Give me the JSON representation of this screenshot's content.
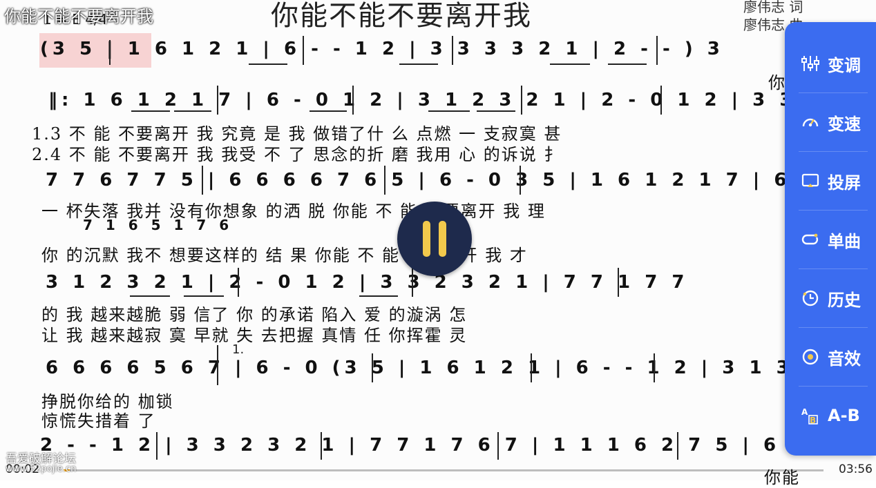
{
  "window": {
    "overlay_title": "你能不能不要离开我"
  },
  "sheet": {
    "title": "你能不能不要离开我",
    "credit_lyric": "廖伟志 词",
    "credit_music": "廖伟志 曲",
    "key": "1 = E 4/4",
    "line1_notes": "(3 5 | 1   6  1  2 1 | 6 - - 1 2 | 3  3  3 3 2 1 | 2 - - ) 3",
    "line1_lyric_tail": "你",
    "line2_notes": "‖: 1  6  1 2 1 7 | 6 - 0  1 2 | 3  1  2 3 2 1 | 2 - 0  1 2 | 3  3 2 3",
    "lyric_v13": "1.3 不  能  不要离开  我        究竟  是  我  做错了什  么       点燃  一  支寂寞  甚",
    "lyric_v24": "2.4 不  能  不要离开  我        我受  不  了  思念的折  磨       我用  心  的诉说  扌",
    "line3_notes": "7  7 6 7  7 5 | 6 6 6 6 7  6 5 | 6 - 0  3 5 | 1  6  1 2 1 7 | 6 - 0",
    "line3_lyric": "一  杯失落  我并  没有你想象  的洒  脱          你能  不  能  不要离开  我       理",
    "line3_sub_notes": "7 1                       6 5    1    7 6",
    "line3_lyric2": "你  的沉默  我不  想要这样的  结   果          你能  不  能  不要离开  我       才",
    "line4_notes": "3  1  2 3 2 1 | 2 - 0  1 2 | 3  3 2 3  2 1 | 7  7 1 7  7",
    "line4_lyric1": "的  我  越来越脆  弱          信了  你  的承诺  陷入  爱  的漩涡  怎",
    "line4_lyric2": "让  我  越来越寂  寞          早就  失  去把握  真情  任  你挥霍  灵",
    "line5_notes": "6 6 6 6 5  6 7 | 6 - 0 (3 5 | 1  6  1  2 1 | 6 - - 1 2 | 3  1  3 2",
    "line5_volta": "1.",
    "line5_lyric1": "挣脱你给的  枷锁",
    "line5_lyric2": "惊慌失措着  了",
    "line6_notes": "2 - - 1 2 | 3  3 2 3  2 1 | 7  7 1 7  6 7 | 1 1 1 6 2  7 5 | 6 - - ) 3",
    "line6_lyric_tail": "你能"
  },
  "controls": {
    "panel_items": [
      {
        "label": "变调",
        "icon": "equalizer-icon"
      },
      {
        "label": "变速",
        "icon": "speedometer-icon"
      },
      {
        "label": "投屏",
        "icon": "cast-icon"
      },
      {
        "label": "单曲",
        "icon": "loop-single-icon"
      },
      {
        "label": "历史",
        "icon": "history-icon"
      },
      {
        "label": "音效",
        "icon": "sound-effect-icon"
      },
      {
        "label": "A-B",
        "icon": "ab-repeat-icon"
      }
    ]
  },
  "player": {
    "time_current": "00:02",
    "time_total": "03:56",
    "progress_fraction": 0.0085,
    "accent_color": "#3b6cf0",
    "progress_color": "#f2a20c"
  },
  "watermark": {
    "line1": "吾爱破解论坛",
    "line2": "www.52pojie.cn"
  }
}
